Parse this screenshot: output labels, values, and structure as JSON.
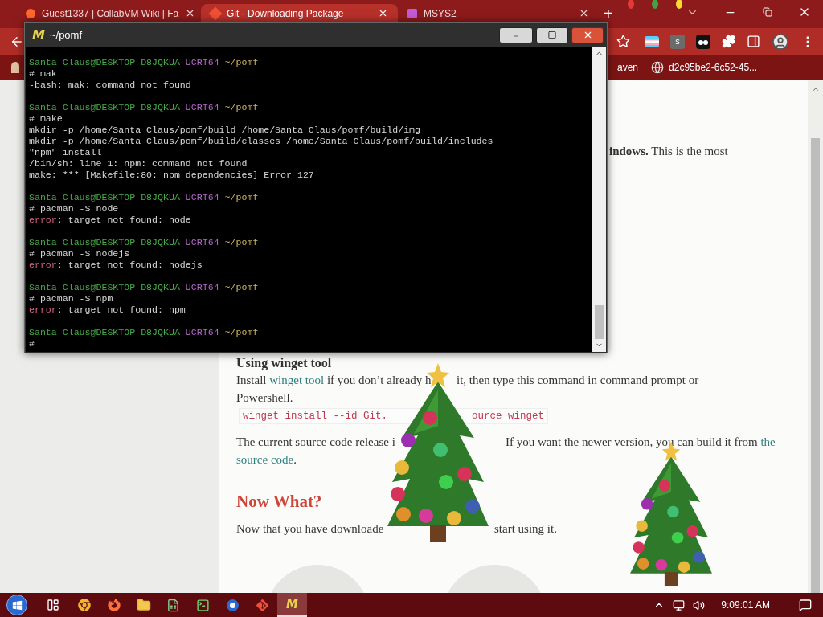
{
  "browser": {
    "tabs": [
      {
        "title": "Guest1337 | CollabVM Wiki | Fa",
        "selected": false
      },
      {
        "title": "Git - Downloading Package",
        "selected": true
      },
      {
        "title": "MSYS2",
        "selected": false
      }
    ],
    "new_tab": "+",
    "extension_letter": "s",
    "bookmarks": [
      {
        "label": "aven"
      },
      {
        "label": "d2c95be2-6c52-45..."
      }
    ],
    "page": {
      "intro_tail": "**indows.** This is the most",
      "winget_heading": "Using winget tool",
      "install_line_1": {
        "before_link": "Install ",
        "link": "winget tool",
        "after_link": " if you don’t already h",
        "after_tree": "it, then type this command in command prompt or"
      },
      "install_line_2": "Powershell.",
      "command": {
        "before_tree": "winget install --id Git.",
        "after_tree": "ource winget"
      },
      "source_line_1": {
        "before_tree": "The current source code release i",
        "after_tree": "If you want the newer version, you can build it from ",
        "link": "the"
      },
      "source_line_2": {
        "link": "source code",
        "after_link": "."
      },
      "now_heading": "Now What?",
      "now_line": {
        "before_tree": "Now that you have downloade",
        "after_tree": "start using it."
      }
    }
  },
  "terminal": {
    "logo_letter": "M",
    "title": "~/pomf",
    "lines": [
      {
        "kind": "prompt",
        "user": "Santa Claus@DESKTOP-D8JQKUA",
        "env": "UCRT64",
        "path": "~/pomf"
      },
      {
        "kind": "command",
        "text": "# mak"
      },
      {
        "kind": "output",
        "text": "-bash: mak: command not found"
      },
      {
        "kind": "blank"
      },
      {
        "kind": "prompt",
        "user": "Santa Claus@DESKTOP-D8JQKUA",
        "env": "UCRT64",
        "path": "~/pomf"
      },
      {
        "kind": "command",
        "text": "# make"
      },
      {
        "kind": "output",
        "text": "mkdir -p /home/Santa Claus/pomf/build /home/Santa Claus/pomf/build/img"
      },
      {
        "kind": "output",
        "text": "mkdir -p /home/Santa Claus/pomf/build/classes /home/Santa Claus/pomf/build/includes"
      },
      {
        "kind": "output",
        "text": "\"npm\" install"
      },
      {
        "kind": "output",
        "text": "/bin/sh: line 1: npm: command not found"
      },
      {
        "kind": "output",
        "text": "make: *** [Makefile:80: npm_dependencies] Error 127"
      },
      {
        "kind": "blank"
      },
      {
        "kind": "prompt",
        "user": "Santa Claus@DESKTOP-D8JQKUA",
        "env": "UCRT64",
        "path": "~/pomf"
      },
      {
        "kind": "command",
        "text": "# pacman -S node"
      },
      {
        "kind": "error",
        "label": "error",
        "text": ": target not found: node"
      },
      {
        "kind": "blank"
      },
      {
        "kind": "prompt",
        "user": "Santa Claus@DESKTOP-D8JQKUA",
        "env": "UCRT64",
        "path": "~/pomf"
      },
      {
        "kind": "command",
        "text": "# pacman -S nodejs"
      },
      {
        "kind": "error",
        "label": "error",
        "text": ": target not found: nodejs"
      },
      {
        "kind": "blank"
      },
      {
        "kind": "prompt",
        "user": "Santa Claus@DESKTOP-D8JQKUA",
        "env": "UCRT64",
        "path": "~/pomf"
      },
      {
        "kind": "command",
        "text": "# pacman -S npm"
      },
      {
        "kind": "error",
        "label": "error",
        "text": ": target not found: npm"
      },
      {
        "kind": "blank"
      },
      {
        "kind": "prompt",
        "user": "Santa Claus@DESKTOP-D8JQKUA",
        "env": "UCRT64",
        "path": "~/pomf"
      },
      {
        "kind": "command",
        "text": "#"
      }
    ]
  },
  "taskbar": {
    "apps": [
      {
        "kind": "chrome",
        "selected": false
      },
      {
        "kind": "firefox",
        "selected": false
      },
      {
        "kind": "folder",
        "selected": false
      },
      {
        "kind": "sheet",
        "selected": false
      },
      {
        "kind": "terminal",
        "selected": false
      },
      {
        "kind": "vm",
        "selected": false
      },
      {
        "kind": "git",
        "selected": false
      },
      {
        "kind": "msys",
        "selected": true
      }
    ],
    "msys_letter": "M",
    "clock": "9:09:01 AM"
  }
}
